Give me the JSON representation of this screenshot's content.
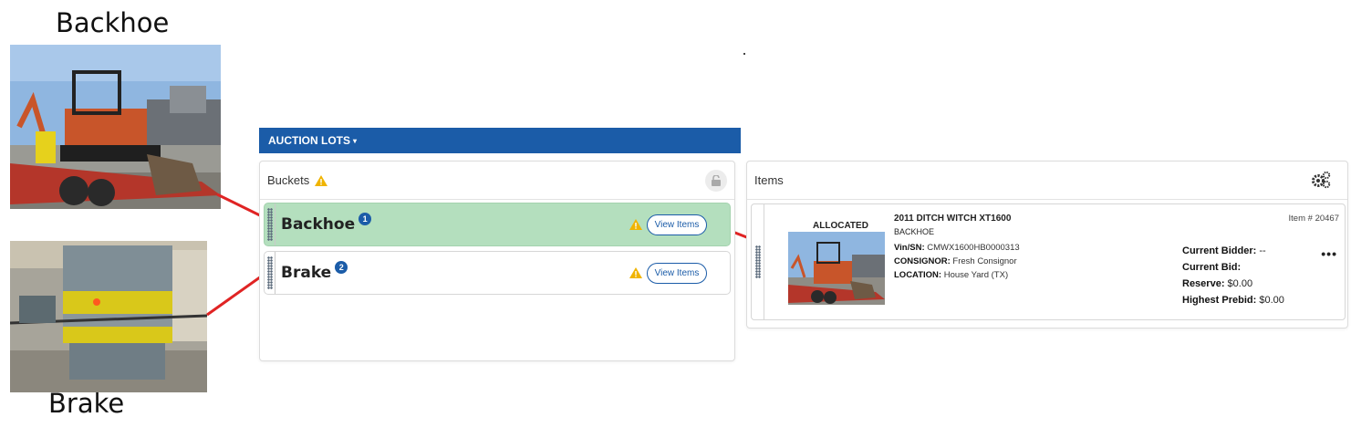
{
  "captions": {
    "backhoe": "Backhoe",
    "brake": "Brake"
  },
  "topbar": {
    "label": "AUCTION LOTS",
    "caret": "▾",
    "color": "#1b5ca8"
  },
  "buckets_panel": {
    "title": "Buckets",
    "header_icon": "warning-icon",
    "lock_icon": "unlock-icon",
    "items": [
      {
        "name": "Backhoe",
        "count": "1",
        "active": true,
        "button_label": "View Items",
        "color": "#b4dfbe"
      },
      {
        "name": "Brake",
        "count": "2",
        "active": false,
        "button_label": "View Items",
        "color": "#ffffff"
      }
    ]
  },
  "items_panel": {
    "title": "Items",
    "settings_icon": "gears-icon",
    "item": {
      "status": "ALLOCATED",
      "title": "2011 DITCH WITCH XT1600",
      "subtitle": "BACKHOE",
      "item_number": "Item # 20467",
      "vin_label": "Vin/SN:",
      "vin": "CMWX1600HB0000313",
      "consignor_label": "CONSIGNOR:",
      "consignor": "Fresh Consignor",
      "location_label": "LOCATION:",
      "location": "House Yard (TX)",
      "current_bidder_label": "Current Bidder:",
      "current_bidder": "--",
      "current_bid_label": "Current Bid:",
      "current_bid": "",
      "reserve_label": "Reserve:",
      "reserve": "$0.00",
      "highest_prebid_label": "Highest Prebid:",
      "highest_prebid": "$0.00",
      "more_label": "•••"
    }
  },
  "connector_color": "#e02424"
}
